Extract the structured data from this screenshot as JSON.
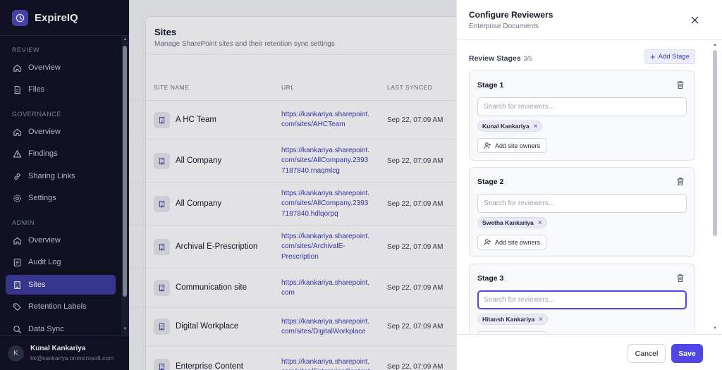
{
  "app": {
    "name": "ExpireIQ",
    "logo_icon": "clock-icon",
    "accent": "#4f46e5"
  },
  "sidebar": {
    "sections": [
      {
        "label": "REVIEW",
        "items": [
          {
            "label": "Overview",
            "icon": "home-icon"
          },
          {
            "label": "Files",
            "icon": "file-icon"
          }
        ]
      },
      {
        "label": "GOVERNANCE",
        "items": [
          {
            "label": "Overview",
            "icon": "home-icon"
          },
          {
            "label": "Findings",
            "icon": "warning-icon"
          },
          {
            "label": "Sharing Links",
            "icon": "link-icon"
          },
          {
            "label": "Settings",
            "icon": "gear-icon"
          }
        ]
      },
      {
        "label": "ADMIN",
        "items": [
          {
            "label": "Overview",
            "icon": "home-icon"
          },
          {
            "label": "Audit Log",
            "icon": "log-icon"
          },
          {
            "label": "Sites",
            "icon": "building-icon",
            "active": true
          },
          {
            "label": "Retention Labels",
            "icon": "tag-icon"
          },
          {
            "label": "Data Sync",
            "icon": "search-icon"
          }
        ]
      }
    ],
    "user": {
      "initial": "K",
      "name": "Kunal Kankariya",
      "email": "kk@kankariya.onmicrosoft.com"
    }
  },
  "sites_page": {
    "title": "Sites",
    "subtitle": "Manage SharePoint sites and their retention sync settings",
    "columns": [
      "SITE NAME",
      "URL",
      "LAST SYNCED"
    ],
    "rows": [
      {
        "name": "A HC Team",
        "url": "https://kankariya.sharepoint.com/sites/AHCTeam",
        "url_lines": [
          "https://kankariya.sharepoint.",
          "com/sites/AHCTeam"
        ],
        "synced": "Sep 22, 07:09 AM"
      },
      {
        "name": "All Company",
        "url": "https://kankariya.sharepoint.com/sites/AllCompany.23937187840.rnaqmlcg",
        "url_lines": [
          "https://kankariya.sharepoint.",
          "com/sites/AllCompany.2393",
          "7187840.rnaqmlcg"
        ],
        "synced": "Sep 22, 07:09 AM"
      },
      {
        "name": "All Company",
        "url": "https://kankariya.sharepoint.com/sites/AllCompany.23937187840.hdlqorpq",
        "url_lines": [
          "https://kankariya.sharepoint.",
          "com/sites/AllCompany.2393",
          "7187840.hdlqorpq"
        ],
        "synced": "Sep 22, 07:09 AM"
      },
      {
        "name": "Archival E-Prescription",
        "url": "https://kankariya.sharepoint.com/sites/ArchivalE-Prescription",
        "url_lines": [
          "https://kankariya.sharepoint.",
          "com/sites/ArchivalE-",
          "Prescription"
        ],
        "synced": "Sep 22, 07:09 AM"
      },
      {
        "name": "Communication site",
        "url": "https://kankariya.sharepoint.com",
        "url_lines": [
          "https://kankariya.sharepoint.",
          "com"
        ],
        "synced": "Sep 22, 07:09 AM"
      },
      {
        "name": "Digital Workplace",
        "url": "https://kankariya.sharepoint.com/sites/DigitalWorkplace",
        "url_lines": [
          "https://kankariya.sharepoint.",
          "com/sites/DigitalWorkplace"
        ],
        "synced": "Sep 22, 07:09 AM"
      },
      {
        "name": "Enterprise Content",
        "url": "https://kankariya.sharepoint.com/sites/EnterpriseContent",
        "url_lines": [
          "https://kankariya.sharepoint.",
          "com/sites/EnterpriseContent"
        ],
        "synced": "Sep 22, 07:09 AM"
      }
    ]
  },
  "panel": {
    "title": "Configure Reviewers",
    "subtitle": "Enterprise Documents",
    "stages_label": "Review Stages",
    "stages_count": "3/5",
    "add_stage_label": "Add Stage",
    "search_placeholder": "Search for reviewers...",
    "add_owners_label": "Add site owners",
    "stages": [
      {
        "title": "Stage 1",
        "reviewer": "Kunal Kankariya",
        "focused": false
      },
      {
        "title": "Stage 2",
        "reviewer": "Swetha Kankariya",
        "focused": false
      },
      {
        "title": "Stage 3",
        "reviewer": "Hitansh Kankariya",
        "focused": true
      }
    ],
    "cancel_label": "Cancel",
    "save_label": "Save"
  }
}
